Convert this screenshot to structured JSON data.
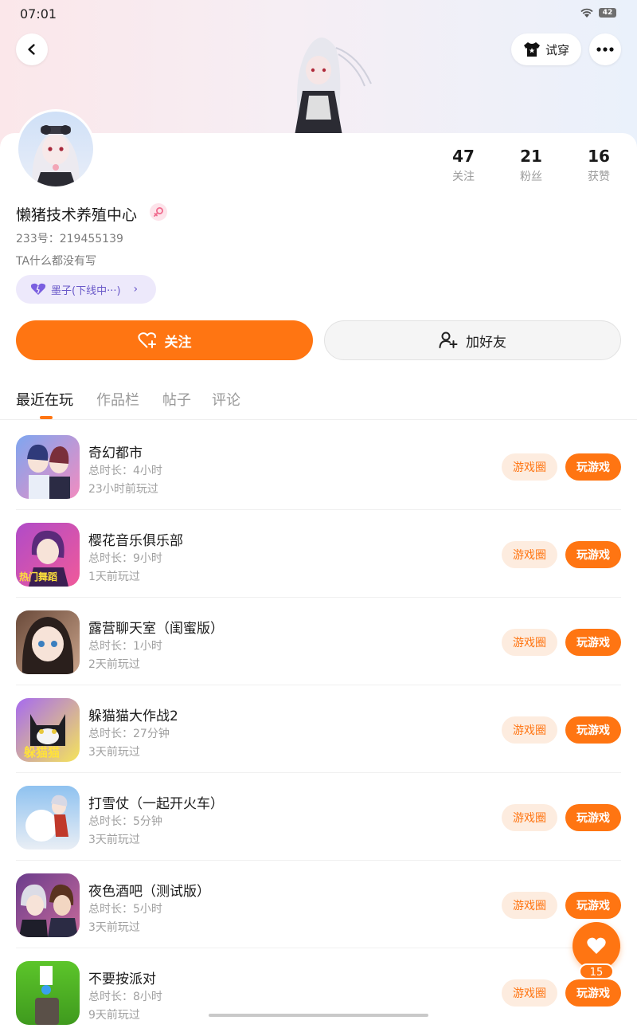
{
  "status_bar": {
    "time": "07:01",
    "battery": "42"
  },
  "header": {
    "try_on_label": "试穿"
  },
  "profile": {
    "nickname": "懒猪技术养殖中心",
    "uid": "233号：219455139",
    "bio": "TA什么都没有写",
    "partner_tag": "墨子(下线中···)",
    "stats": [
      {
        "value": "47",
        "label": "关注"
      },
      {
        "value": "21",
        "label": "粉丝"
      },
      {
        "value": "16",
        "label": "获赞"
      }
    ]
  },
  "actions": {
    "follow_label": "关注",
    "add_friend_label": "加好友"
  },
  "tabs": [
    {
      "label": "最近在玩",
      "active": true
    },
    {
      "label": "作品栏",
      "active": false
    },
    {
      "label": "帖子",
      "active": false
    },
    {
      "label": "评论",
      "active": false
    }
  ],
  "games": [
    {
      "title": "奇幻都市",
      "duration": "总时长：4小时",
      "last_played": "23小时前玩过",
      "circle_label": "游戏圈",
      "play_label": "玩游戏",
      "icon_colors": [
        "#7ea6f0",
        "#f28cc0"
      ]
    },
    {
      "title": "樱花音乐俱乐部",
      "duration": "总时长：9小时",
      "last_played": "1天前玩过",
      "circle_label": "游戏圈",
      "play_label": "玩游戏",
      "icon_colors": [
        "#b04bc8",
        "#f05a9a"
      ],
      "icon_text": "热门舞蹈"
    },
    {
      "title": "露营聊天室（闺蜜版）",
      "duration": "总时长：1小时",
      "last_played": "2天前玩过",
      "circle_label": "游戏圈",
      "play_label": "玩游戏",
      "icon_colors": [
        "#6a4a3a",
        "#c9a38a"
      ]
    },
    {
      "title": "躲猫猫大作战2",
      "duration": "总时长：27分钟",
      "last_played": "3天前玩过",
      "circle_label": "游戏圈",
      "play_label": "玩游戏",
      "icon_colors": [
        "#a66af0",
        "#f5e45a"
      ],
      "icon_text": "躲猫猫"
    },
    {
      "title": "打雪仗（一起开火车）",
      "duration": "总时长：5分钟",
      "last_played": "3天前玩过",
      "circle_label": "游戏圈",
      "play_label": "玩游戏",
      "icon_colors": [
        "#8fc2f0",
        "#e9eef5"
      ]
    },
    {
      "title": "夜色酒吧（测试版）",
      "duration": "总时长：5小时",
      "last_played": "3天前玩过",
      "circle_label": "游戏圈",
      "play_label": "玩游戏",
      "icon_colors": [
        "#6b3c8c",
        "#c76a9a"
      ]
    },
    {
      "title": "不要按派对",
      "duration": "总时长：8小时",
      "last_played": "9天前玩过",
      "circle_label": "游戏圈",
      "play_label": "玩游戏",
      "icon_colors": [
        "#5cc52a",
        "#3f9a1e"
      ]
    }
  ],
  "like_fab": {
    "count": "15"
  },
  "colors": {
    "accent": "#ff7512",
    "accent_soft": "#fdecdf",
    "tag_bg": "#ede9fb",
    "tag_text": "#6a59c9"
  }
}
